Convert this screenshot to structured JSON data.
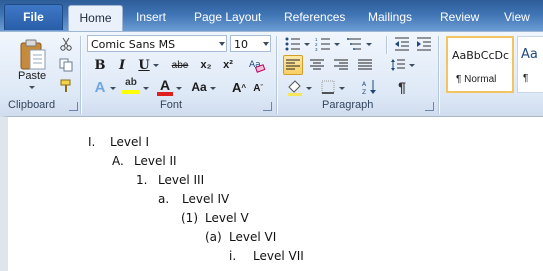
{
  "tabs": {
    "file": "File",
    "home": "Home",
    "insert": "Insert",
    "page_layout": "Page Layout",
    "references": "References",
    "mailings": "Mailings",
    "review": "Review",
    "view": "View"
  },
  "clipboard": {
    "paste_label": "Paste",
    "group_label": "Clipboard"
  },
  "font": {
    "name": "Comic Sans MS",
    "size": "10",
    "group_label": "Font",
    "case_label": "Aa",
    "highlight_label": "ab",
    "font_color_label": "A"
  },
  "paragraph": {
    "group_label": "Paragraph"
  },
  "styles": {
    "normal_sample": "AaBbCcDc",
    "normal_name": "¶ Normal",
    "next_sample": "Aa",
    "next_name": "¶"
  },
  "colors": {
    "highlight": "#ffff00",
    "font_color": "#e02020",
    "tab_bar": "#3f74b4"
  },
  "document": {
    "levels": [
      {
        "num": "I.",
        "text": "Level I"
      },
      {
        "num": "A.",
        "text": "Level II"
      },
      {
        "num": "1.",
        "text": "Level III"
      },
      {
        "num": "a.",
        "text": "Level IV"
      },
      {
        "num": "(1)",
        "text": "Level V"
      },
      {
        "num": "(a)",
        "text": "Level VI"
      },
      {
        "num": "i.",
        "text": "Level VII"
      }
    ]
  }
}
